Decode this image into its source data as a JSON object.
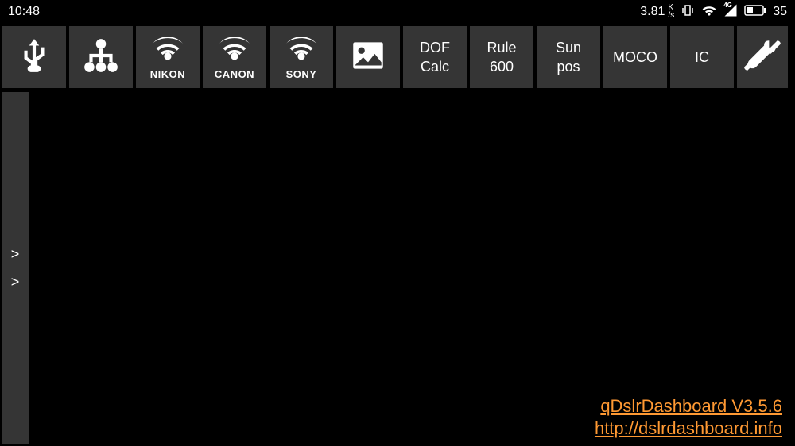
{
  "status": {
    "time": "10:48",
    "speed": "3.81",
    "speed_unit_top": "K",
    "speed_unit_bottom": "/s",
    "network_type": "4G",
    "battery": "35"
  },
  "toolbar": {
    "usb": "usb",
    "network": "network",
    "nikon_label": "NIKON",
    "canon_label": "CANON",
    "sony_label": "SONY",
    "image": "image",
    "dof_line1": "DOF",
    "dof_line2": "Calc",
    "rule_line1": "Rule",
    "rule_line2": "600",
    "sun_line1": "Sun",
    "sun_line2": "pos",
    "moco": "MOCO",
    "ic": "IC",
    "tools": "tools"
  },
  "sidebar": {
    "item1": ">",
    "item2": ">"
  },
  "footer": {
    "app_name": "qDslrDashboard V3.5.6",
    "url": "http://dslrdashboard.info"
  }
}
